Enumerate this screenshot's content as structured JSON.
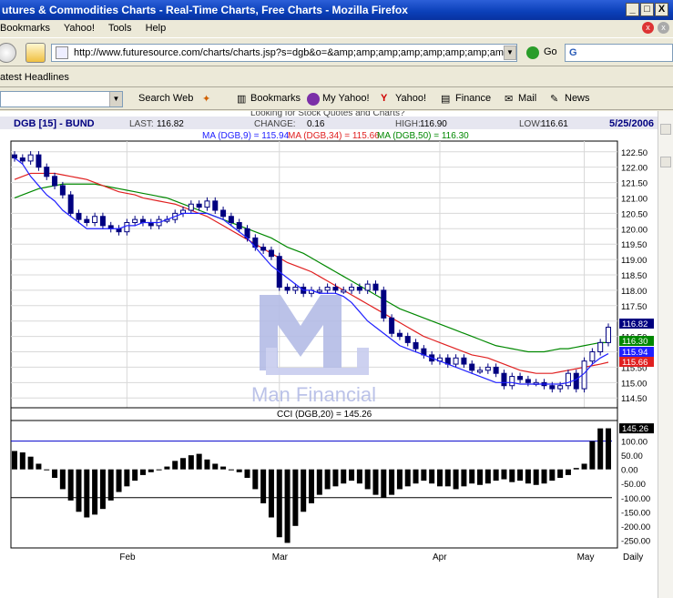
{
  "window": {
    "title": "utures & Commodities Charts - Real-Time Charts, Free Charts - Mozilla Firefox",
    "min": "_",
    "max": "□",
    "close": "X"
  },
  "menu": {
    "items": [
      "Bookmarks",
      "Yahoo!",
      "Tools",
      "Help"
    ]
  },
  "nav": {
    "url": "http://www.futuresource.com/charts/charts.jsp?s=dgb&o=&amp;amp;amp;amp;amp;amp;amp;amp;amp;a=",
    "go_label": "Go",
    "search_value": "G"
  },
  "bookmarks_bar": {
    "item": "atest Headlines"
  },
  "yahoo_toolbar": {
    "search_web": "Search Web",
    "bookmarks": "Bookmarks",
    "my_yahoo": "My Yahoo!",
    "yahoo": "Yahoo!",
    "finance": "Finance",
    "mail": "Mail",
    "news": "News"
  },
  "chart_header": {
    "symbol": "DGB [15] - BUND",
    "last_label": "LAST:",
    "last": "116.82",
    "change_label": "CHANGE:",
    "change": "0.16",
    "high_label": "HIGH:",
    "high": "116.90",
    "low_label": "LOW:",
    "low": "116.61",
    "date": "5/25/2006",
    "ad_text": "Looking for Stock Quotes and Charts?",
    "ma9": "MA (DGB,9) = 115.94",
    "ma34": "MA (DGB,34) = 115.66",
    "ma50": "MA (DGB,50) = 116.30",
    "watermark": "Man Financial",
    "cci_title": "CCI (DGB,20) = 145.26"
  },
  "colors": {
    "ma9": "#2020ff",
    "ma34": "#e02020",
    "ma50": "#008800",
    "candle": "#000080",
    "last": "#000080",
    "watermark": "#b4bce6"
  },
  "chart_data": [
    {
      "type": "candlestick",
      "y_ticks": [
        "122.50",
        "122.00",
        "121.50",
        "121.00",
        "120.50",
        "120.00",
        "119.50",
        "119.00",
        "118.50",
        "118.00",
        "117.50",
        "117.00",
        "116.50",
        "116.00",
        "115.50",
        "115.00",
        "114.50"
      ],
      "ylim": [
        114.3,
        122.7
      ],
      "x_ticks": [
        "Feb",
        "Mar",
        "Apr",
        "May",
        "Daily"
      ],
      "price_labels": [
        {
          "name": "last",
          "text": "116.82",
          "value": 116.82
        },
        {
          "name": "ma50",
          "text": "116.30",
          "value": 116.3
        },
        {
          "name": "ma9",
          "text": "115.94",
          "value": 115.94
        },
        {
          "name": "ma34",
          "text": "115.66",
          "value": 115.66
        }
      ],
      "close": [
        122.3,
        122.2,
        122.4,
        122.0,
        121.7,
        121.4,
        121.1,
        120.5,
        120.3,
        120.2,
        120.4,
        120.1,
        120.0,
        119.9,
        120.2,
        120.3,
        120.2,
        120.1,
        120.3,
        120.3,
        120.5,
        120.6,
        120.8,
        120.7,
        120.9,
        120.6,
        120.4,
        120.2,
        120.0,
        119.7,
        119.4,
        119.3,
        119.1,
        118.1,
        118.0,
        118.1,
        117.9,
        118.0,
        118.0,
        118.1,
        118.0,
        118.0,
        118.1,
        118.0,
        118.2,
        118.0,
        117.1,
        116.6,
        116.5,
        116.3,
        116.1,
        115.9,
        115.7,
        115.8,
        115.6,
        115.8,
        115.6,
        115.4,
        115.4,
        115.5,
        115.3,
        114.9,
        115.2,
        115.1,
        115.0,
        115.0,
        114.9,
        114.8,
        114.9,
        115.3,
        114.8,
        115.7,
        116.0,
        116.3,
        116.8
      ],
      "ma9": [
        122.3,
        122.1,
        121.7,
        121.4,
        121.1,
        120.9,
        120.6,
        120.4,
        120.2,
        120.0,
        120.0,
        120.0,
        120.0,
        120.0,
        120.1,
        120.1,
        120.2,
        120.2,
        120.2,
        120.3,
        120.4,
        120.5,
        120.5,
        120.5,
        120.5,
        120.4,
        120.3,
        120.1,
        119.9,
        119.7,
        119.4,
        119.1,
        118.8,
        118.6,
        118.4,
        118.2,
        118.0,
        118.0,
        117.9,
        117.9,
        117.9,
        117.8,
        117.6,
        117.3,
        117.0,
        116.8,
        116.6,
        116.4,
        116.2,
        116.1,
        116.0,
        115.9,
        115.8,
        115.7,
        115.6,
        115.5,
        115.4,
        115.3,
        115.2,
        115.1,
        115.0,
        115.0,
        115.0,
        114.95,
        114.95,
        114.95,
        114.95,
        114.95,
        114.95,
        115.0,
        115.1,
        115.3,
        115.6,
        115.8,
        115.94
      ],
      "ma34": [
        121.6,
        121.7,
        121.8,
        121.8,
        121.8,
        121.8,
        121.75,
        121.7,
        121.65,
        121.6,
        121.5,
        121.4,
        121.3,
        121.2,
        121.15,
        121.1,
        121.0,
        120.95,
        120.9,
        120.85,
        120.8,
        120.7,
        120.6,
        120.5,
        120.4,
        120.25,
        120.1,
        119.95,
        119.8,
        119.65,
        119.5,
        119.35,
        119.2,
        119.05,
        118.9,
        118.8,
        118.7,
        118.6,
        118.45,
        118.3,
        118.15,
        118.0,
        117.85,
        117.7,
        117.55,
        117.4,
        117.25,
        117.1,
        116.95,
        116.8,
        116.65,
        116.5,
        116.4,
        116.3,
        116.2,
        116.1,
        116.0,
        115.9,
        115.85,
        115.8,
        115.7,
        115.6,
        115.5,
        115.4,
        115.35,
        115.3,
        115.3,
        115.3,
        115.35,
        115.4,
        115.45,
        115.5,
        115.55,
        115.6,
        115.66
      ],
      "ma50": [
        121.0,
        121.1,
        121.2,
        121.3,
        121.35,
        121.4,
        121.45,
        121.45,
        121.45,
        121.45,
        121.45,
        121.4,
        121.35,
        121.3,
        121.25,
        121.2,
        121.15,
        121.1,
        121.05,
        121.0,
        120.9,
        120.8,
        120.7,
        120.6,
        120.5,
        120.4,
        120.3,
        120.2,
        120.1,
        120.0,
        119.9,
        119.8,
        119.7,
        119.55,
        119.4,
        119.3,
        119.2,
        119.05,
        118.9,
        118.75,
        118.6,
        118.45,
        118.3,
        118.15,
        118.0,
        117.85,
        117.7,
        117.55,
        117.4,
        117.3,
        117.2,
        117.1,
        117.0,
        116.9,
        116.8,
        116.7,
        116.6,
        116.5,
        116.4,
        116.3,
        116.2,
        116.15,
        116.1,
        116.05,
        116.0,
        116.0,
        116.0,
        116.05,
        116.1,
        116.1,
        116.15,
        116.2,
        116.25,
        116.3,
        116.3
      ]
    },
    {
      "type": "bar",
      "y_ticks": [
        "150.00",
        "100.00",
        "50.00",
        "0.00",
        "-50.00",
        "-100.00",
        "-150.00",
        "-200.00",
        "-250.00"
      ],
      "ylim": [
        -265,
        160
      ],
      "reference_lines": [
        100,
        -100
      ],
      "last_label": "145.26",
      "values": [
        65,
        60,
        45,
        20,
        0,
        -30,
        -70,
        -110,
        -150,
        -170,
        -160,
        -140,
        -110,
        -80,
        -60,
        -40,
        -20,
        -10,
        0,
        10,
        30,
        40,
        50,
        55,
        35,
        20,
        10,
        0,
        -10,
        -30,
        -70,
        -120,
        -170,
        -240,
        -260,
        -200,
        -150,
        -120,
        -90,
        -70,
        -60,
        -50,
        -40,
        -50,
        -70,
        -90,
        -100,
        -90,
        -70,
        -60,
        -50,
        -40,
        -50,
        -60,
        -60,
        -70,
        -60,
        -50,
        -55,
        -50,
        -40,
        -35,
        -45,
        -40,
        -50,
        -55,
        -50,
        -40,
        -30,
        -20,
        5,
        20,
        100,
        145,
        145.26
      ]
    }
  ]
}
